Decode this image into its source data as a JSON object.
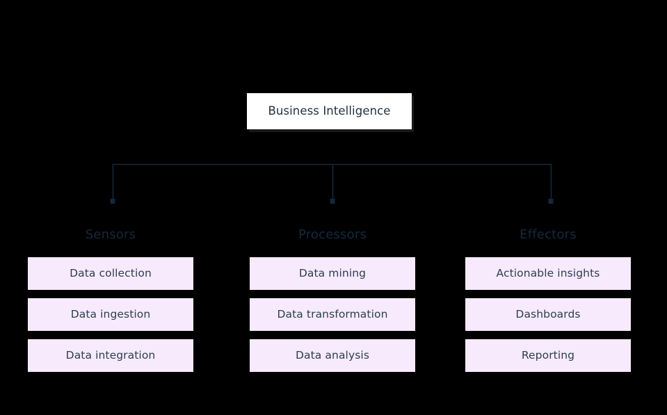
{
  "diagram": {
    "title": "Business Intelligence",
    "root": {
      "label": "Business Intelligence"
    },
    "colors": {
      "background": "#000000",
      "root_fill": "#ffffff",
      "root_text": "#22313f",
      "connector": "#14293c",
      "branch_title_text": "#14293c",
      "item_fill": "#f7eafd",
      "item_text": "#2c3e4e"
    },
    "branches": [
      {
        "title": "Sensors",
        "items": [
          {
            "label": "Data collection"
          },
          {
            "label": "Data ingestion"
          },
          {
            "label": "Data integration"
          }
        ]
      },
      {
        "title": "Processors",
        "items": [
          {
            "label": "Data mining"
          },
          {
            "label": "Data transformation"
          },
          {
            "label": "Data analysis"
          }
        ]
      },
      {
        "title": "Effectors",
        "items": [
          {
            "label": "Actionable insights"
          },
          {
            "label": "Dashboards"
          },
          {
            "label": "Reporting"
          }
        ]
      }
    ]
  }
}
